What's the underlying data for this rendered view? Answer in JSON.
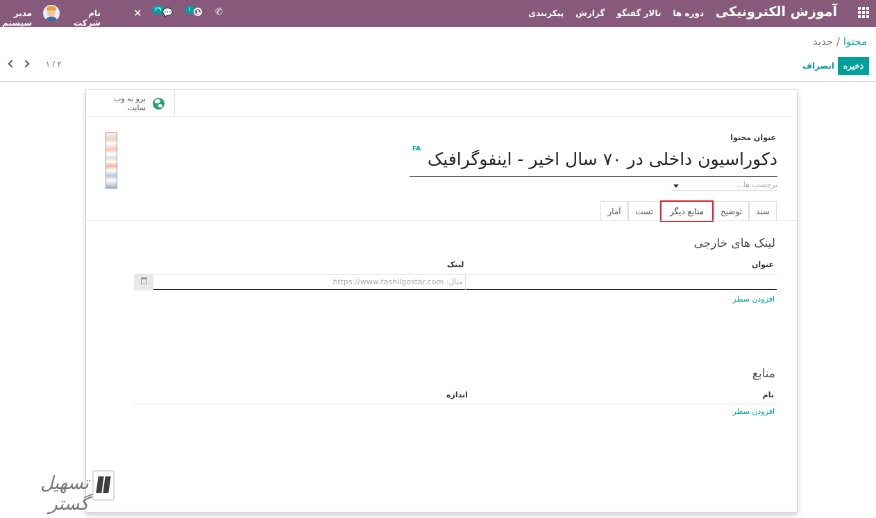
{
  "navbar": {
    "brand": "آموزش الکترونیکی",
    "menu": [
      "دوره ها",
      "تالار گفتگو",
      "گزارش",
      "پیکربندی"
    ],
    "user_name": "مدیر سیستم",
    "company_name": "نام شرکت شما",
    "chat_count": "۲۹",
    "activity_count": "۱"
  },
  "control_panel": {
    "breadcrumb_parent": "محتوا",
    "breadcrumb_sep": "/",
    "breadcrumb_current": "جدید",
    "save_label": "ذخیره",
    "discard_label": "انصراف",
    "pager": "۱ / ۲"
  },
  "form": {
    "goto_site": "برو به وب سایت",
    "content_title_label": "عنوان محتوا",
    "content_title": "دکوراسیون داخلی در ۷۰ سال اخیر - اینفوگرافیک",
    "lang_badge": "FA",
    "tags_placeholder": "برچسب ها...",
    "tabs": [
      "سند",
      "توضیح",
      "منابع دیگر",
      "تست",
      "آمار"
    ],
    "external_links": {
      "title": "لینک های خارجی",
      "col_title": "عنوان",
      "col_link": "لینک",
      "link_placeholder": "مثال: https://www.tashilgostar.com",
      "add_line": "افزودن سطر"
    },
    "resources": {
      "title": "منابع",
      "col_name": "نام",
      "col_size": "اندازه",
      "add_line": "افزودن سطر"
    }
  },
  "watermark": {
    "text": "تسهیل گستر"
  },
  "colors": {
    "navbar": "#875a7b",
    "accent": "#00a09d",
    "active_tab_outline": "#e0202a"
  },
  "icons": [
    "apps-icon",
    "phone-icon",
    "clock-icon",
    "chat-icon",
    "company-icon",
    "globe-icon",
    "trash-icon",
    "caret-down-icon",
    "chevron-left-icon",
    "chevron-right-icon"
  ]
}
